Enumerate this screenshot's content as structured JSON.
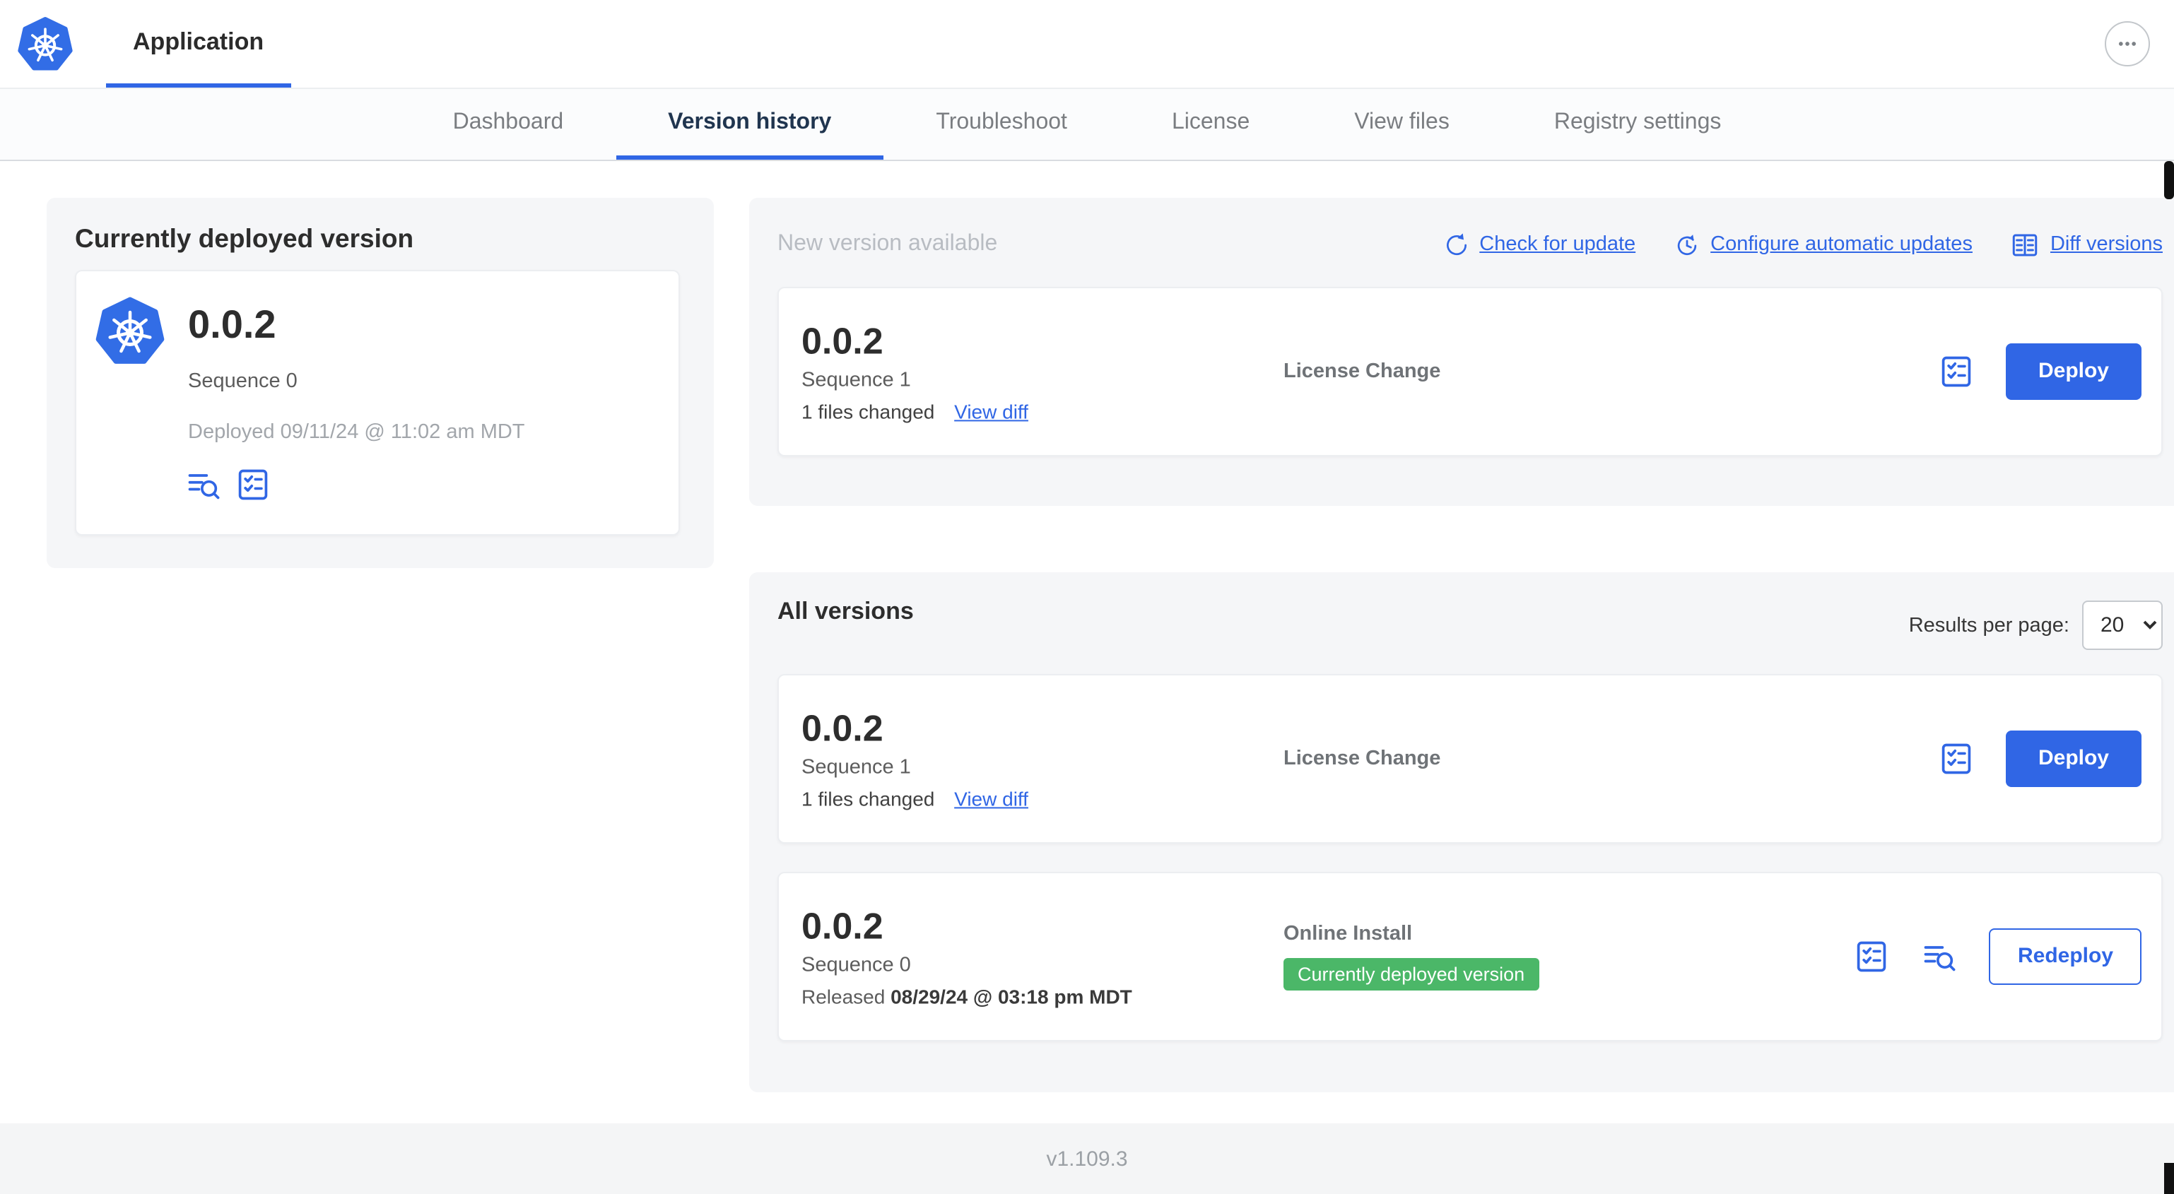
{
  "header": {
    "app_title": "Application"
  },
  "nav": {
    "tabs": [
      "Dashboard",
      "Version history",
      "Troubleshoot",
      "License",
      "View files",
      "Registry settings"
    ],
    "active_tab": "Version history"
  },
  "currently_deployed": {
    "title": "Currently deployed version",
    "version": "0.0.2",
    "sequence": "Sequence 0",
    "deployed_at": "Deployed 09/11/24 @ 11:02 am MDT"
  },
  "new_version": {
    "title": "New version available",
    "check_for_update": "Check for update",
    "configure_automatic_updates": "Configure automatic updates",
    "diff_versions": "Diff versions",
    "version": "0.0.2",
    "sequence": "Sequence 1",
    "files_changed": "1 files changed",
    "view_diff": "View diff",
    "source": "License Change",
    "deploy": "Deploy"
  },
  "all_versions": {
    "title": "All versions",
    "results_per_page_label": "Results per page:",
    "results_per_page": "20",
    "rows": [
      {
        "version": "0.0.2",
        "sequence": "Sequence 1",
        "files_changed": "1 files changed",
        "view_diff": "View diff",
        "source": "License Change",
        "action": "Deploy"
      },
      {
        "version": "0.0.2",
        "sequence": "Sequence 0",
        "released_label": "Released",
        "released_at": "08/29/24 @ 03:18 pm MDT",
        "source": "Online Install",
        "badge": "Currently deployed version",
        "action": "Redeploy"
      }
    ]
  },
  "footer": {
    "version": "v1.109.3"
  },
  "colors": {
    "accent": "#3066e5",
    "kubernetes_blue": "#326de6",
    "badge_green": "#4bb768",
    "panel_bg": "#f5f6f8"
  }
}
